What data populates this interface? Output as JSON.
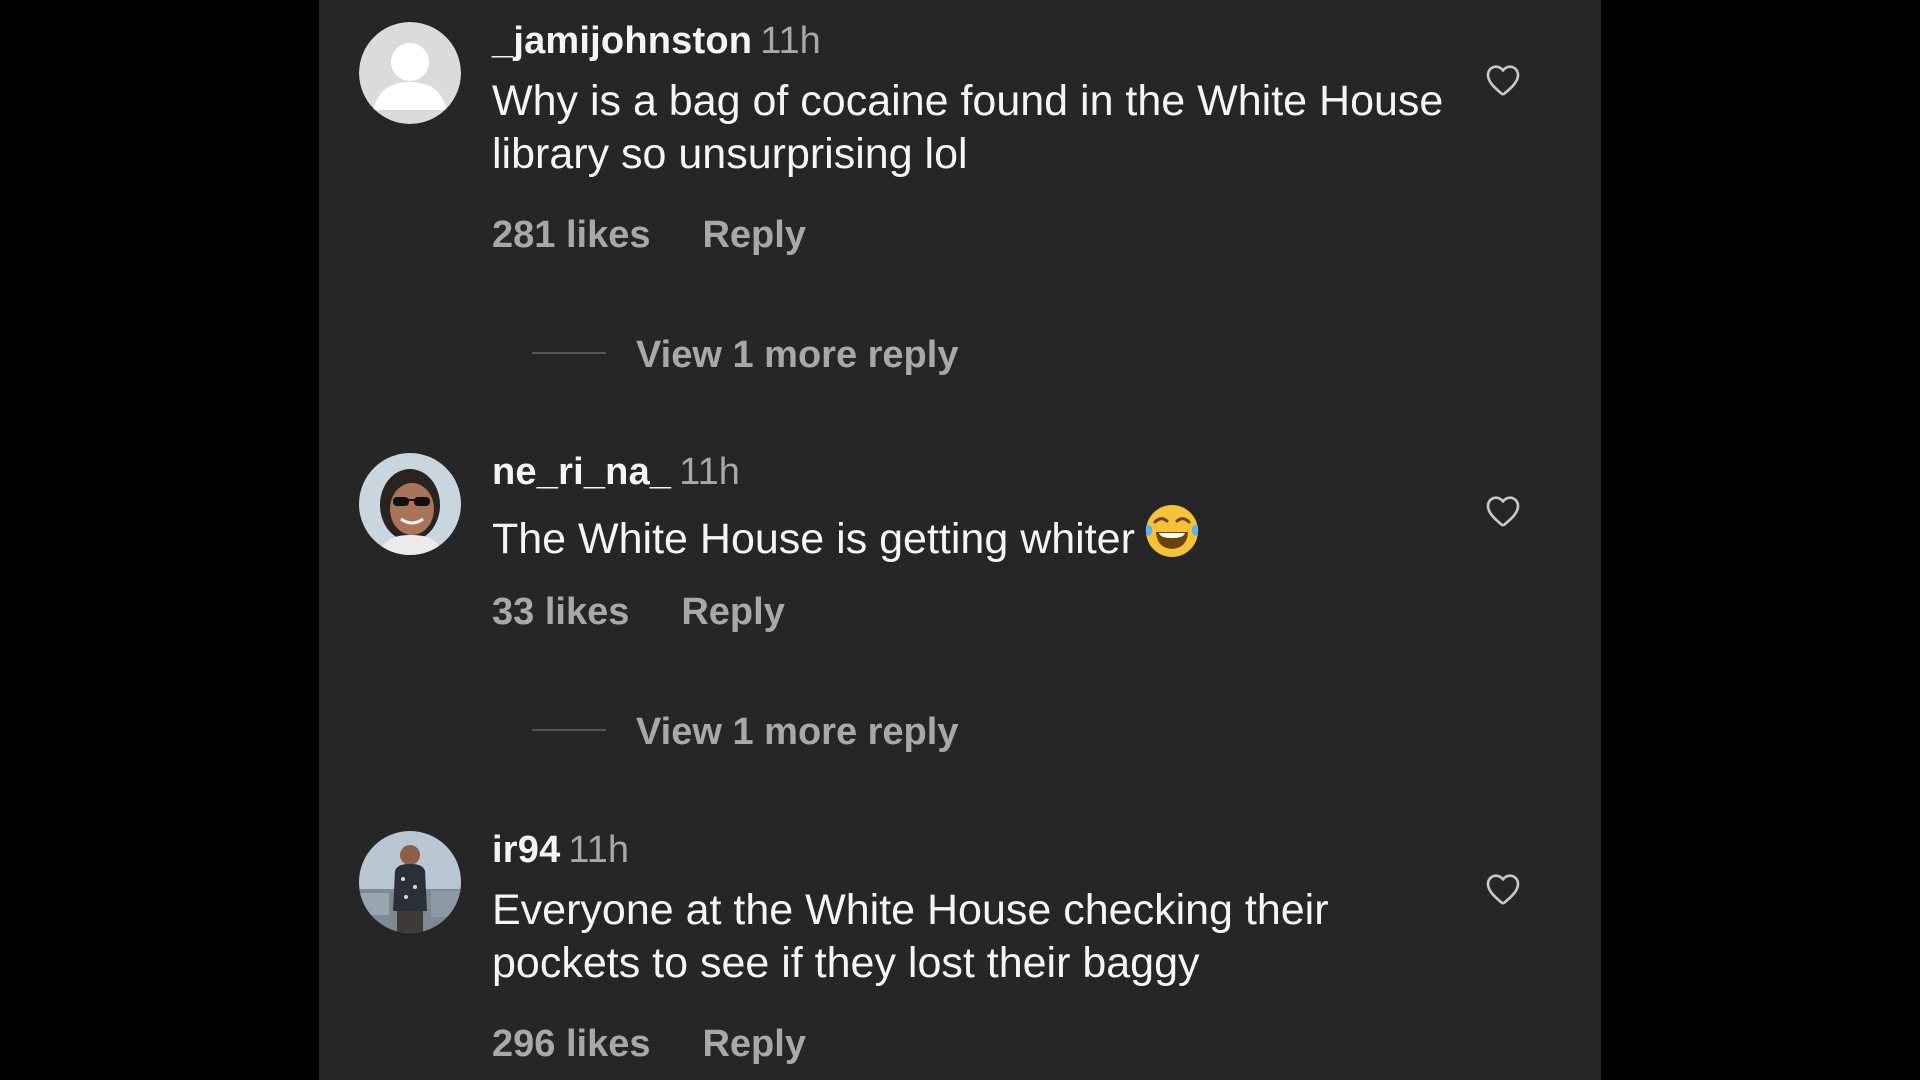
{
  "colors": {
    "page_bg": "#000000",
    "panel_bg": "#262626",
    "text_primary": "#f5f5f5",
    "text_secondary": "#a8a8a8"
  },
  "comments": [
    {
      "username": "_jamijohnston",
      "time": "11h",
      "text": "Why is a bag of cocaine found in the White House library so unsurprising lol",
      "likes": "281 likes",
      "reply_label": "Reply",
      "view_more": "View 1 more reply",
      "avatar": "default-avatar-icon"
    },
    {
      "username": "ne_ri_na_",
      "time": "11h",
      "text": "The White House is getting whiter",
      "emoji": "face-with-tears-of-joy",
      "likes": "33 likes",
      "reply_label": "Reply",
      "view_more": "View 1 more reply",
      "avatar": "profile-photo"
    },
    {
      "username": "ir94",
      "time": "11h",
      "text": "Everyone at the White House checking their pockets to see if they lost their baggy",
      "likes": "296 likes",
      "reply_label": "Reply",
      "avatar": "profile-photo"
    }
  ],
  "icons": {
    "like": "heart-outline-icon"
  }
}
